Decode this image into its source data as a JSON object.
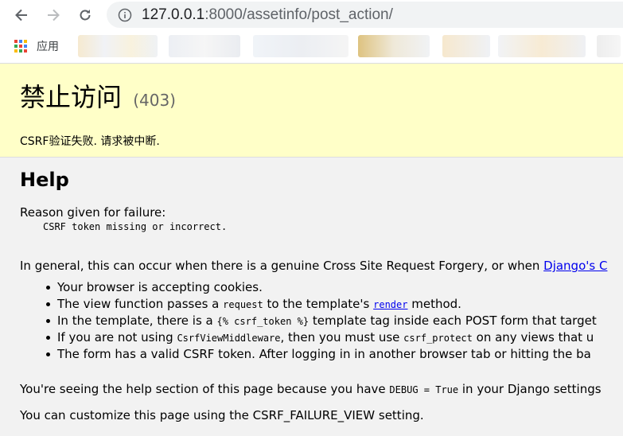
{
  "browser": {
    "url_host": "127.0.0.1",
    "url_rest": ":8000/assetinfo/post_action/",
    "bookmarks_apps_label": "应用",
    "icons": [
      "back-arrow-icon",
      "forward-arrow-icon",
      "reload-icon",
      "info-icon",
      "apps-grid-icon"
    ]
  },
  "summary": {
    "title": "禁止访问",
    "code": "(403)",
    "message": "CSRF验证失败. 请求被中断."
  },
  "info": {
    "help_title": "Help",
    "reason_label": "Reason given for failure:",
    "reason_code": "CSRF token missing or incorrect.",
    "general_text": "In general, this can occur when there is a genuine Cross Site Request Forgery, or when ",
    "general_link": "Django's C",
    "bullets": [
      {
        "pre": "Your browser is accepting cookies.",
        "code": "",
        "mid": "",
        "link": "",
        "post": ""
      },
      {
        "pre": "The view function passes a ",
        "code": "request",
        "mid": " to the template's ",
        "link": "render",
        "post": " method."
      },
      {
        "pre": "In the template, there is a ",
        "code": "{% csrf_token %}",
        "mid": " template tag inside each POST form that target",
        "link": "",
        "post": ""
      },
      {
        "pre": "If you are not using ",
        "code": "CsrfViewMiddleware",
        "mid": ", then you must use ",
        "code2": "csrf_protect",
        "post": " on any views that u"
      },
      {
        "pre": "The form has a valid CSRF token. After logging in in another browser tab or hitting the ba",
        "code": "",
        "mid": "",
        "link": "",
        "post": ""
      }
    ],
    "debug_pre": "You're seeing the help section of this page because you have ",
    "debug_code": "DEBUG = True",
    "debug_post": " in your Django settings",
    "customize_text": "You can customize this page using the CSRF_FAILURE_VIEW setting."
  },
  "colors": {
    "summary_bg": "#ffffc8",
    "info_bg": "#f2f2f2",
    "link": "#0000ee"
  }
}
